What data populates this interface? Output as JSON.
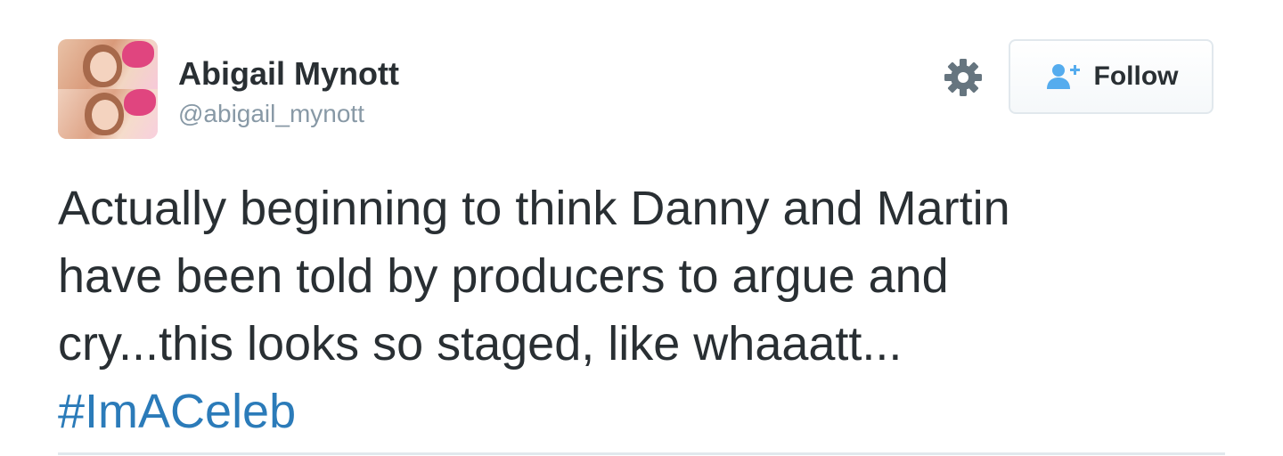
{
  "user": {
    "display_name": "Abigail Mynott",
    "handle": "@abigail_mynott"
  },
  "actions": {
    "settings_icon": "gear-icon",
    "follow_label": "Follow",
    "follow_icon": "add-user-icon"
  },
  "tweet": {
    "lines": [
      "Actually beginning to think Danny and Martin",
      "have been told by producers to argue and",
      "cry...this looks so staged, like whaaatt..."
    ],
    "hashtag": "#ImACeleb"
  },
  "colors": {
    "text": "#292f33",
    "secondary": "#8899a6",
    "link": "#2b7bb9",
    "follow_icon": "#55acee",
    "border": "#e1e8ed"
  }
}
